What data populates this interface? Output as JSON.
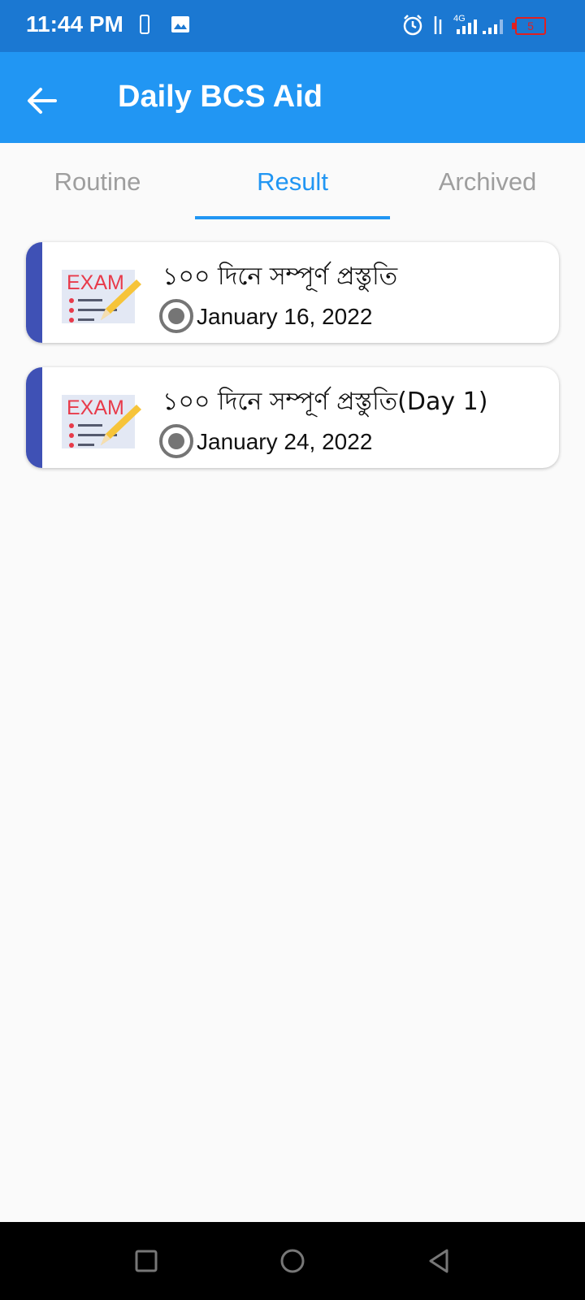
{
  "status_bar": {
    "time": "11:44 PM",
    "network_label": "4G",
    "battery_level": "5"
  },
  "app_bar": {
    "title": "Daily BCS Aid",
    "back_icon": "arrow-left-icon"
  },
  "tabs": [
    {
      "label": "Routine",
      "active": false
    },
    {
      "label": "Result",
      "active": true
    },
    {
      "label": "Archived",
      "active": false
    }
  ],
  "results": [
    {
      "title": "১০০ দিনে সম্পূর্ণ প্রস্তুতি",
      "date": "January 16, 2022",
      "thumb_text": "EXAM"
    },
    {
      "title": "১০০ দিনে সম্পূর্ণ প্রস্তুতি(Day 1)",
      "date": "January 24, 2022",
      "thumb_text": "EXAM"
    }
  ],
  "colors": {
    "status_bar": "#1b78d2",
    "app_bar": "#2196f3",
    "card_accent": "#3f51b5",
    "tab_inactive": "#9e9e9e"
  }
}
